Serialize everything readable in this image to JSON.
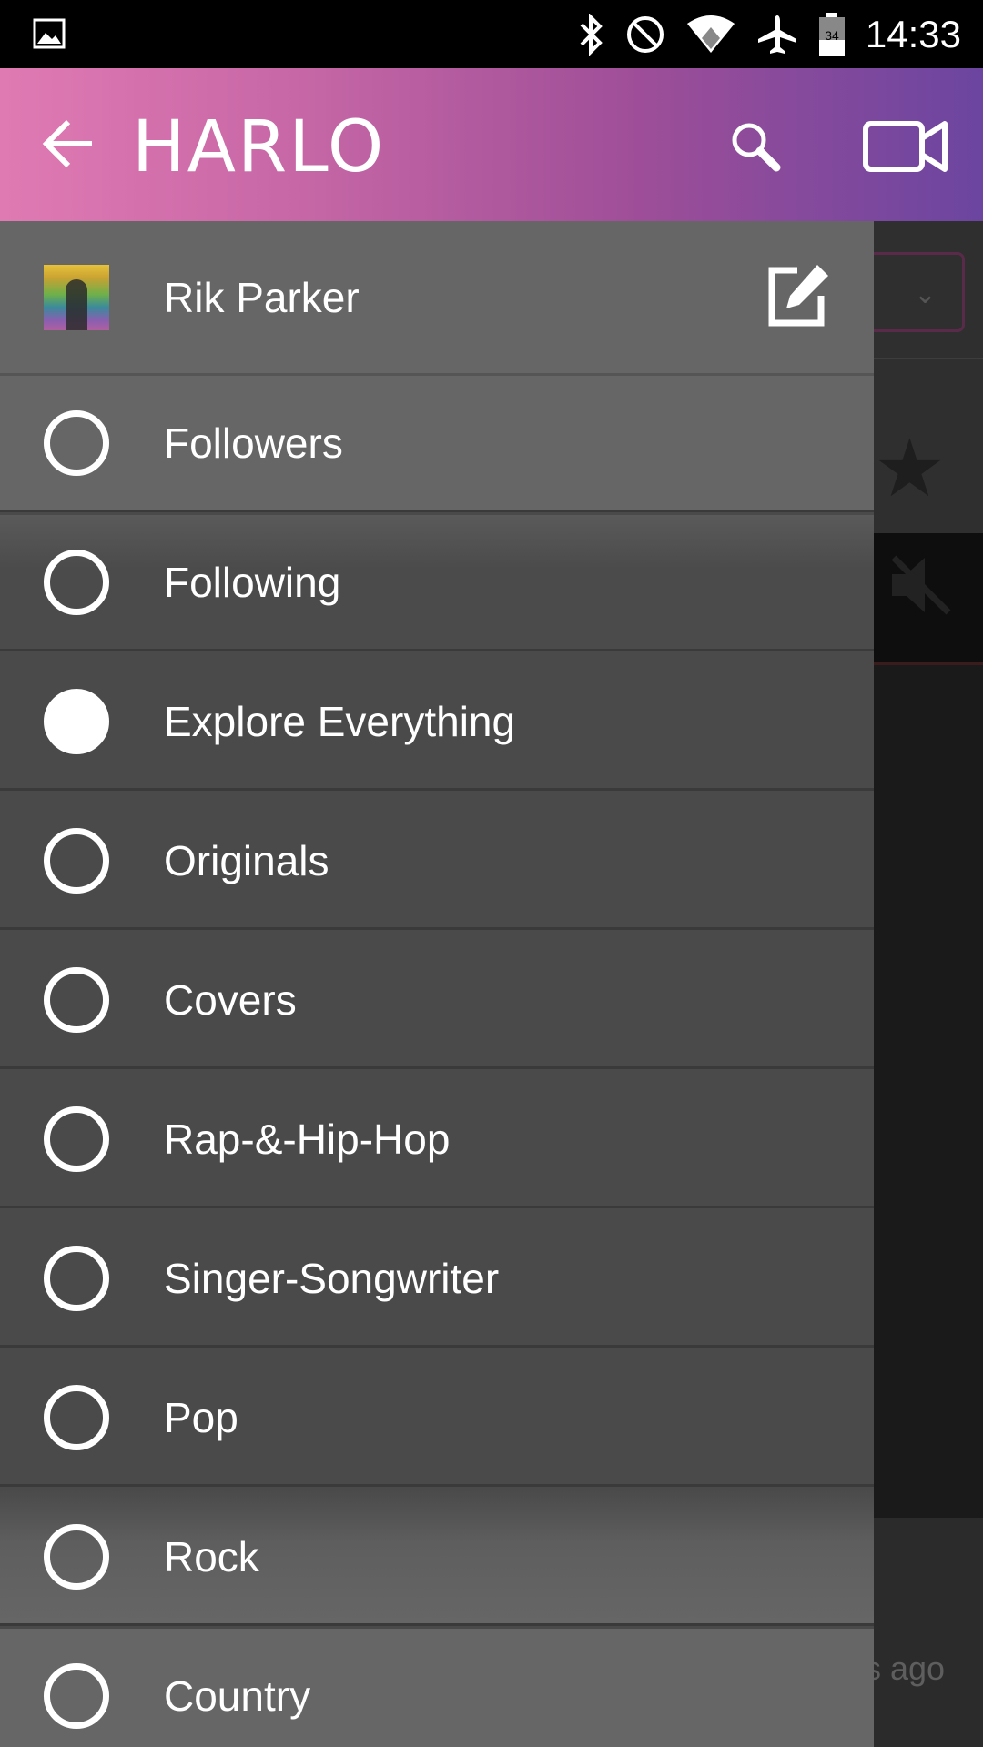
{
  "status_bar": {
    "time": "14:33",
    "battery_level": "34",
    "icons": [
      "gallery-icon",
      "bluetooth-icon",
      "do-not-disturb-icon",
      "wifi-icon",
      "airplane-icon",
      "battery-icon"
    ]
  },
  "app_bar": {
    "logo_text": "HARLO",
    "icons": [
      "back-arrow-icon",
      "search-icon",
      "video-camera-icon"
    ],
    "gradient_colors": [
      "#e07ab3",
      "#9e4e98",
      "#6b45a0"
    ]
  },
  "drawer": {
    "profile": {
      "name": "Rik Parker",
      "edit_icon": "edit-icon"
    },
    "items": [
      {
        "label": "Followers",
        "selected": false
      },
      {
        "label": "Following",
        "selected": false
      },
      {
        "label": "Explore Everything",
        "selected": true
      },
      {
        "label": "Originals",
        "selected": false
      },
      {
        "label": "Covers",
        "selected": false
      },
      {
        "label": "Rap-&-Hip-Hop",
        "selected": false
      },
      {
        "label": "Singer-Songwriter",
        "selected": false
      },
      {
        "label": "Pop",
        "selected": false
      },
      {
        "label": "Rock",
        "selected": false
      },
      {
        "label": "Country",
        "selected": false
      }
    ]
  },
  "background": {
    "timestamp_fragment": "s ago",
    "icons": [
      "star-icon",
      "mute-icon",
      "chevron-down-icon"
    ]
  }
}
